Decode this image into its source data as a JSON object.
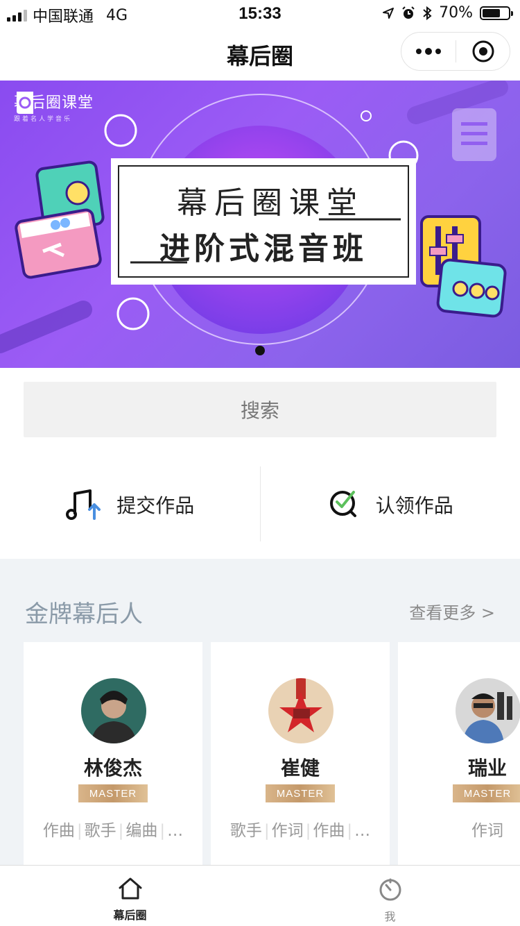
{
  "status_bar": {
    "carrier": "中国联通",
    "network": "4G",
    "time": "15:33",
    "battery": "70%",
    "battery_level": 0.7
  },
  "nav": {
    "title": "幕后圈"
  },
  "banner": {
    "logo_text": "幕后圈课堂",
    "logo_sub": "跟着名人学音乐",
    "line1": "幕后圈课堂",
    "line2": "进阶式混音班"
  },
  "search": {
    "placeholder": "搜索"
  },
  "actions": {
    "submit": "提交作品",
    "claim": "认领作品"
  },
  "gold": {
    "title": "金牌幕后人",
    "more": "查看更多 >",
    "people": [
      {
        "name": "林俊杰",
        "badge": "MASTER",
        "tags": [
          "作曲",
          "歌手",
          "编曲",
          "…"
        ]
      },
      {
        "name": "崔健",
        "badge": "MASTER",
        "tags": [
          "歌手",
          "作词",
          "作曲",
          "…"
        ]
      },
      {
        "name": "瑞业",
        "badge": "MASTER",
        "tags": [
          "作词"
        ]
      }
    ]
  },
  "tabs": {
    "home": "幕后圈",
    "me": "我"
  },
  "colors": {
    "banner_purple": "#8a4bf0",
    "gold_badge": "#c4996a",
    "section_bg": "#f0f3f6",
    "upload_arrow": "#4a8fe0",
    "check_green": "#5cc05c"
  }
}
